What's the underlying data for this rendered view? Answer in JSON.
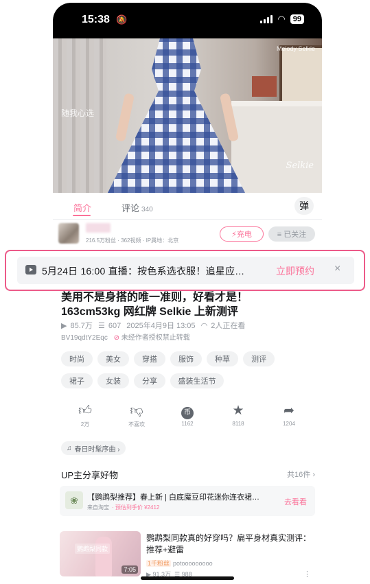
{
  "status_bar": {
    "time": "15:38",
    "mute_icon": "bell-off-icon",
    "battery": "99"
  },
  "video": {
    "watermark_brand": "Selkie",
    "watermark_left": "随我心选",
    "watermark_top": "Melody Selkie"
  },
  "tabs": {
    "intro": "简介",
    "comments": "评论",
    "comments_count": "340",
    "danmaku_icon": "danmaku-toggle-icon"
  },
  "uploader": {
    "stats": "216.5万粉丝 · 362视频 · IP属地：北京",
    "charge_label": "⚡充电",
    "follow_label": "≡ 已关注"
  },
  "live_banner": {
    "text": "5月24日 16:00 直播：按色系选衣服！追星应…",
    "cta": "立即预约",
    "close": "×"
  },
  "video_info": {
    "title_line1": "美用不是身搭的唯一准则，好看才是！",
    "title_line2": "163cm53kg 网红牌 Selkie 上新测评",
    "views": "85.7万",
    "danmaku": "607",
    "date": "2025年4月9日 13:05",
    "watching": "2人正在看",
    "bvid": "BV19qdtY2Eqc",
    "no_repost": "未经作者授权禁止转载"
  },
  "tags": [
    "时尚",
    "美女",
    "穿搭",
    "服饰",
    "种草",
    "测评",
    "裙子",
    "女装",
    "分享",
    "盛装生活节"
  ],
  "actions": [
    {
      "name": "like",
      "icon": "thumbs-up-icon",
      "count": "2万"
    },
    {
      "name": "dislike",
      "icon": "thumbs-down-icon",
      "count": "不喜欢"
    },
    {
      "name": "coin",
      "icon": "coin-icon",
      "count": "1162"
    },
    {
      "name": "favorite",
      "icon": "star-icon",
      "count": "8118"
    },
    {
      "name": "share",
      "icon": "share-icon",
      "count": "1204"
    }
  ],
  "bgm": {
    "label": "春日时髦序曲 ›"
  },
  "share_section": {
    "title": "UP主分享好物",
    "more": "共16件 ›"
  },
  "goods": {
    "title": "【鹦鹉梨推荐】春上新 | 白底魔豆印花迷你连衣裙…",
    "source": "来自淘宝",
    "price": "· 预估到手价 ¥2412",
    "cta": "去看看"
  },
  "recommended": {
    "title": "鹦鹉梨同款真的好穿吗？扁平身材真实测评：推荐+避雷",
    "thumb_badge": "鹦鹉梨同款",
    "duration": "7:05",
    "up_tag": "1千粉丝",
    "up_name": "potooooooooo",
    "views": "91.3万",
    "danmaku": "988"
  },
  "colors": {
    "accent": "#fb7299",
    "highlight_border": "#ec5a89"
  }
}
